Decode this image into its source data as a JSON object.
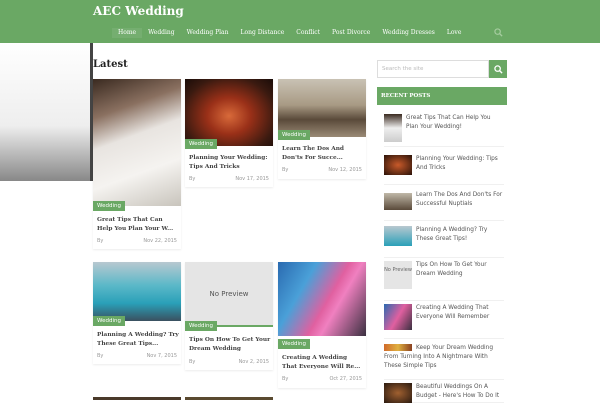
{
  "header": {
    "title": "AEC Wedding",
    "nav": [
      "Home",
      "Wedding",
      "Wedding Plan",
      "Long Distance",
      "Conflict",
      "Post Divorce",
      "Wedding Dresses",
      "Love"
    ]
  },
  "main": {
    "heading": "Latest",
    "posts": [
      {
        "tag": "Wedding",
        "title": "Great Tips That Can Help You Plan Your W...",
        "by": "By",
        "date": "Nov 22, 2015"
      },
      {
        "tag": "Wedding",
        "title": "Planning Your Wedding: Tips And Tricks",
        "by": "By",
        "date": "Nov 17, 2015"
      },
      {
        "tag": "Wedding",
        "title": "Learn The Dos And Don'ts For Succe...",
        "by": "By",
        "date": "Nov 12, 2015"
      },
      {
        "tag": "Wedding",
        "title": "Planning A Wedding? Try These Great Tips...",
        "by": "By",
        "date": "Nov 7, 2015"
      },
      {
        "tag": "Wedding",
        "title": "Tips On How To Get Your Dream Wedding",
        "by": "By",
        "date": "Nov 2, 2015",
        "preview": "No Preview"
      },
      {
        "tag": "Wedding",
        "title": "Creating A Wedding That Everyone Will Re...",
        "by": "By",
        "date": "Oct 27, 2015"
      }
    ]
  },
  "sidebar": {
    "search_placeholder": "Search the site",
    "recent_title": "RECENT POSTS",
    "recent": [
      "Great Tips That Can Help You Plan Your Wedding!",
      "Planning Your Wedding: Tips And Tricks",
      "Learn The Dos And Don'ts For Successful Nuptials",
      "Planning A Wedding? Try These Great Tips!",
      "Tips On How To Get Your Dream Wedding",
      "Creating A Wedding That Everyone Will Remember",
      "Keep Your Dream Wedding From Turning Into A Nightmare With These Simple Tips",
      "Beautiful Weddings On A Budget - Here's How To Do It"
    ],
    "no_preview": "No Preview"
  },
  "colors": {
    "accent": "#6aa864"
  }
}
